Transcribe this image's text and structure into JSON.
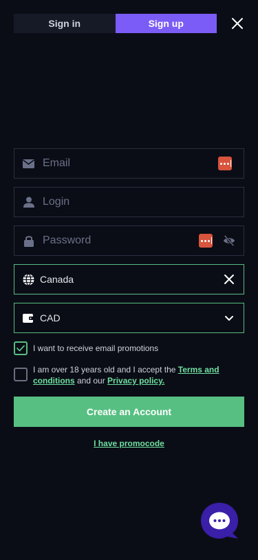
{
  "tabs": [
    {
      "label": "Sign in",
      "active": false
    },
    {
      "label": "Sign up",
      "active": true
    }
  ],
  "form": {
    "email_placeholder": "Email",
    "login_placeholder": "Login",
    "password_placeholder": "Password",
    "country_value": "Canada",
    "currency_value": "CAD"
  },
  "checks": {
    "promo_label": "I want to receive email promotions",
    "promo_checked": true,
    "terms_prefix": "I am over 18 years old and I accept the ",
    "terms_link": "Terms and conditions",
    "terms_middle": " and our ",
    "privacy_link": "Privacy policy.",
    "terms_checked": false
  },
  "actions": {
    "create_account": "Create an Account",
    "promocode": "I have promocode"
  },
  "colors": {
    "accent_purple": "#7b5cf6",
    "accent_green": "#57bf82",
    "background": "#0b0d16"
  },
  "icons": {
    "close": "close-icon",
    "email": "envelope-icon",
    "login": "user-icon",
    "password": "lock-icon",
    "country": "globe-icon",
    "currency": "wallet-icon",
    "chat": "chat-icon"
  }
}
